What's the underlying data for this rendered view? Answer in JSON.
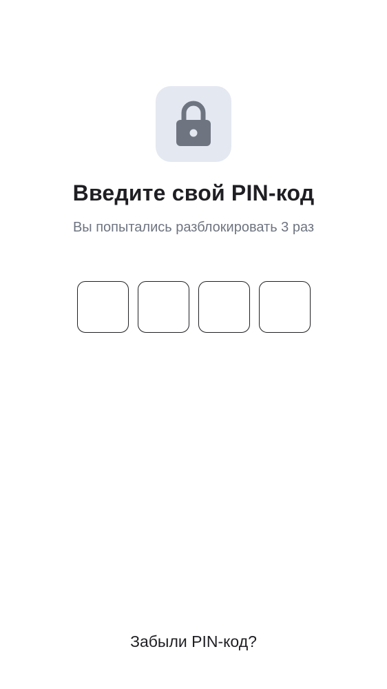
{
  "lock": {
    "icon": "lock-icon",
    "tile_color": "#e4e8f1",
    "icon_color": "#6e7480"
  },
  "title": "Введите свой PIN-код",
  "subtitle": "Вы попытались разблокировать 3 раз",
  "pin": {
    "length": 4,
    "cells": [
      "",
      "",
      "",
      ""
    ]
  },
  "forgot_label": "Забыли PIN-код?",
  "colors": {
    "text_primary": "#1f1f23",
    "text_secondary": "#6e7480",
    "background": "#ffffff"
  }
}
